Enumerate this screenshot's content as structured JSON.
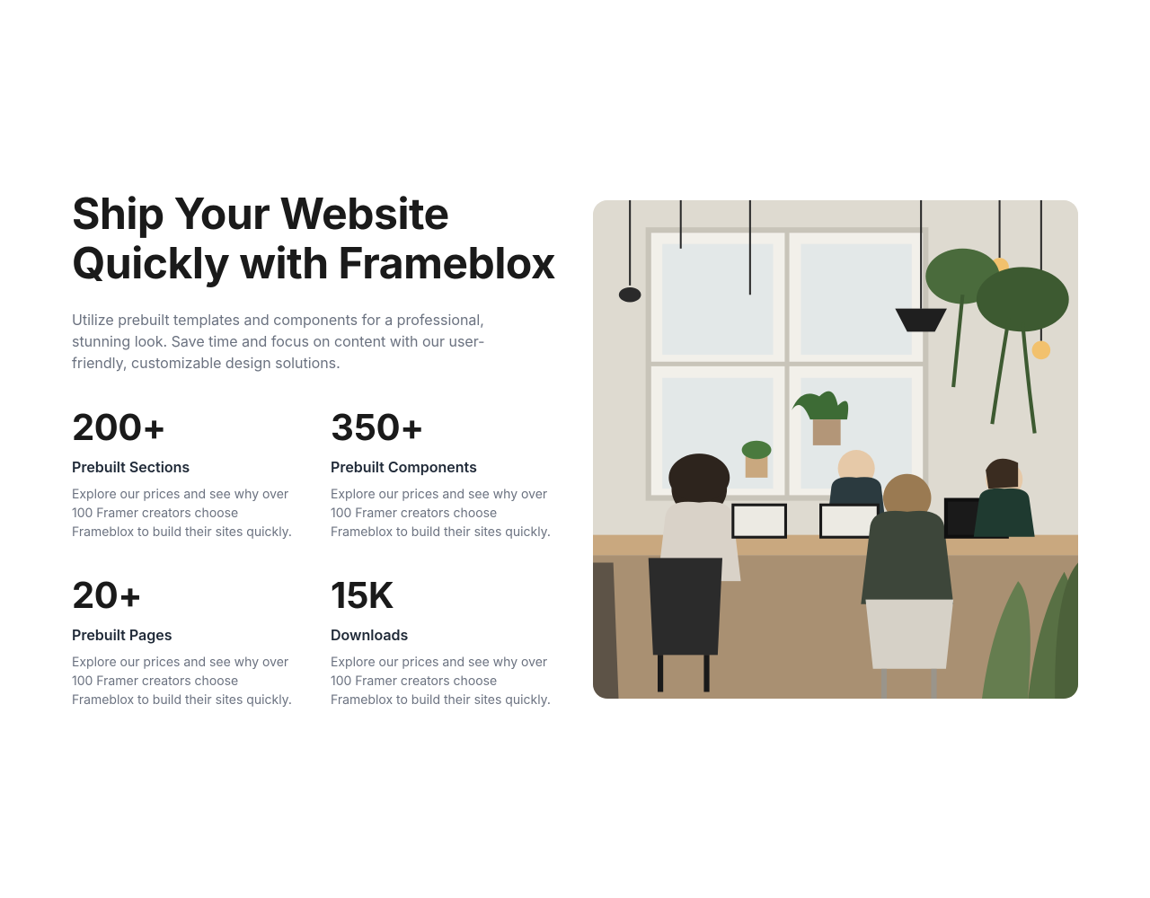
{
  "headline": "Ship Your Website Quickly with Frameblox",
  "subhead": "Utilize prebuilt templates and components for a professional, stunning look. Save time and focus on content with our user-friendly, customizable design solutions.",
  "stats": [
    {
      "value": "200+",
      "label": "Prebuilt Sections",
      "desc": "Explore our prices and see why over 100 Framer creators choose Frameblox to build their sites quickly."
    },
    {
      "value": "350+",
      "label": "Prebuilt Components",
      "desc": "Explore our prices and see why over 100 Framer creators choose Frameblox to build their sites quickly."
    },
    {
      "value": "20+",
      "label": "Prebuilt Pages",
      "desc": "Explore our prices and see why over 100 Framer creators choose Frameblox to build their sites quickly."
    },
    {
      "value": "15K",
      "label": "Downloads",
      "desc": "Explore our prices and see why over 100 Framer creators choose Frameblox to build their sites quickly."
    }
  ],
  "image_alt": "office-workspace-photo"
}
